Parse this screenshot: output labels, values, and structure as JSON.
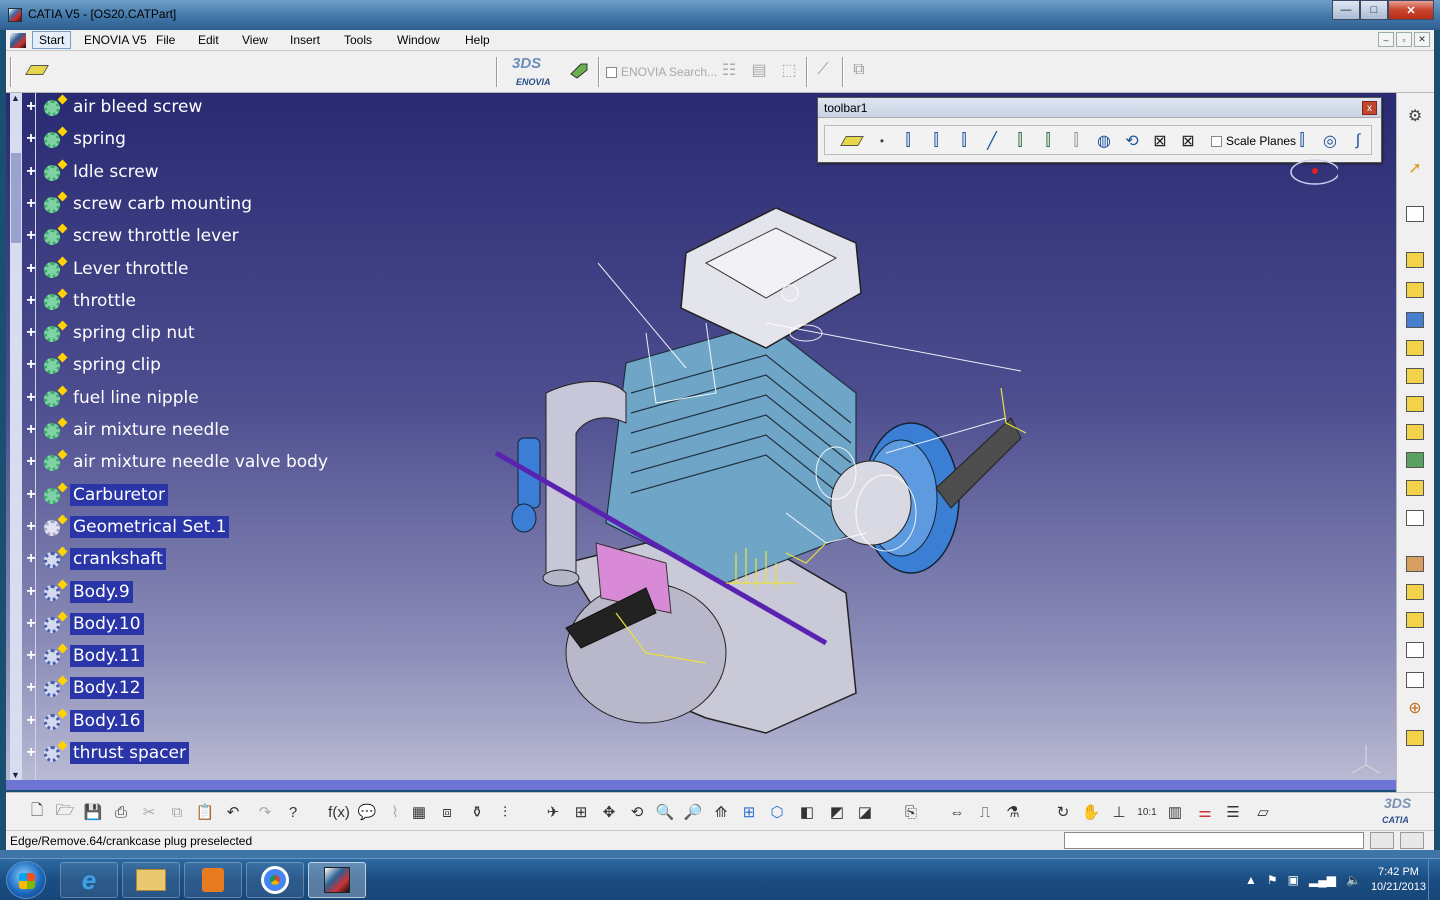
{
  "window": {
    "title": "CATIA V5 - [OS20.CATPart]",
    "minimize": "—",
    "maximize": "□",
    "close": "✕"
  },
  "menu": {
    "items": [
      "Start",
      "ENOVIA V5",
      "File",
      "Edit",
      "View",
      "Insert",
      "Tools",
      "Window",
      "Help"
    ],
    "mdi_min": "–",
    "mdi_restore": "▫",
    "mdi_close": "✕"
  },
  "top_toolbar": {
    "enovia_logo_ds": "3DS",
    "enovia_logo_text": "ENOVIA",
    "enovia_search": "ENOVIA Search..."
  },
  "tree": {
    "items": [
      {
        "label": "air bleed screw",
        "icon": "part-body-icon"
      },
      {
        "label": "spring",
        "icon": "part-body-icon"
      },
      {
        "label": "Idle screw",
        "icon": "part-body-icon"
      },
      {
        "label": "screw carb mounting",
        "icon": "part-body-icon"
      },
      {
        "label": "screw throttle lever",
        "icon": "part-body-icon"
      },
      {
        "label": "Lever throttle",
        "icon": "part-body-icon"
      },
      {
        "label": "throttle",
        "icon": "part-body-icon"
      },
      {
        "label": "spring clip nut",
        "icon": "part-body-icon"
      },
      {
        "label": "spring clip",
        "icon": "part-body-icon"
      },
      {
        "label": "fuel line nipple",
        "icon": "part-body-icon"
      },
      {
        "label": "air mixture needle",
        "icon": "part-body-icon"
      },
      {
        "label": "air mixture needle valve body",
        "icon": "part-body-icon"
      },
      {
        "label": "Carburetor",
        "icon": "part-body-icon"
      },
      {
        "label": "Geometrical Set.1",
        "icon": "geometrical-set-icon"
      },
      {
        "label": "crankshaft",
        "icon": "body-icon"
      },
      {
        "label": "Body.9",
        "icon": "body-icon"
      },
      {
        "label": "Body.10",
        "icon": "body-icon"
      },
      {
        "label": "Body.11",
        "icon": "body-icon"
      },
      {
        "label": "Body.12",
        "icon": "body-icon"
      },
      {
        "label": "Body.16",
        "icon": "body-icon"
      },
      {
        "label": "thrust spacer",
        "icon": "body-icon"
      }
    ]
  },
  "toolbar1": {
    "title": "toolbar1",
    "close": "x",
    "scale_planes_label": "Scale Planes"
  },
  "status": {
    "message": "Edge/Remove.64/crankcase plug preselected",
    "command_value": ""
  },
  "bottom_toolbar": {
    "catia_logo_ds": "3DS",
    "catia_logo_text": "CATIA"
  },
  "taskbar": {
    "time": "7:42 PM",
    "date": "10/21/2013"
  },
  "colors": {
    "viewport_top": "#2a2a73",
    "viewport_bottom": "#b9bad3",
    "tree_highlight": "#2a36a8",
    "hscroll": "#6e74d4"
  }
}
